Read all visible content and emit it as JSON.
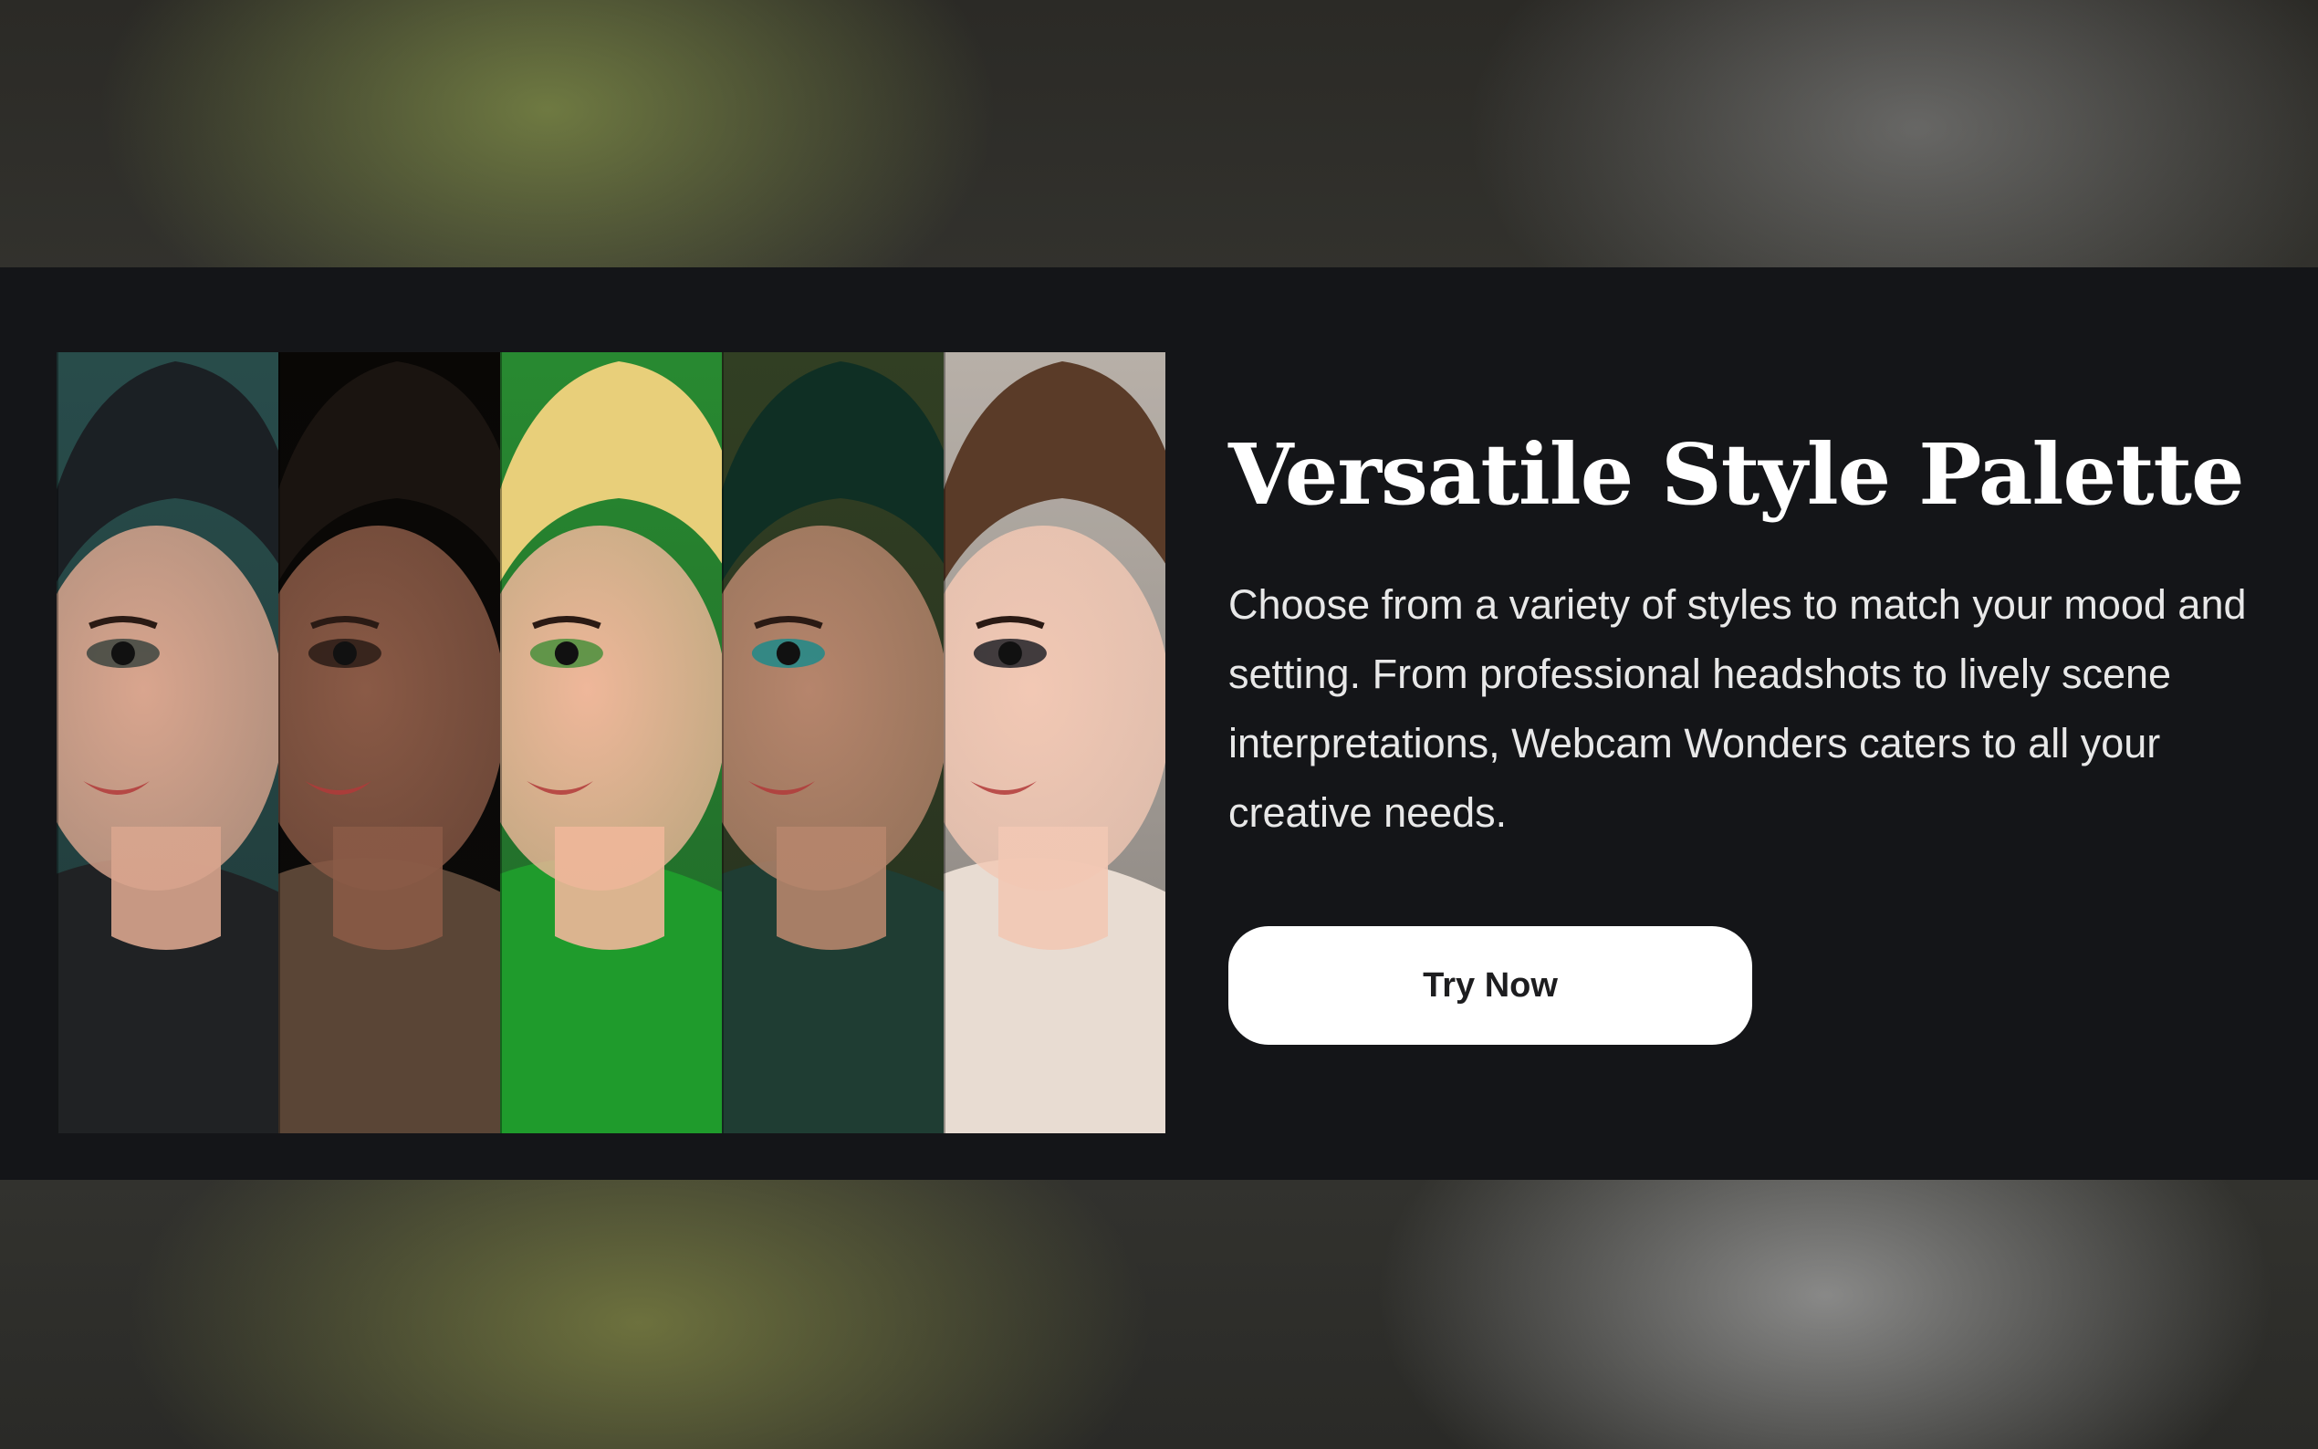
{
  "feature": {
    "title": "Versatile Style Palette",
    "description": "Choose from a variety of styles to match your mood and setting. From professional headshots to lively scene interpretations, Webcam Wonders caters to all your creative needs.",
    "cta_label": "Try Now"
  },
  "gallery": {
    "items": [
      {
        "style": "dark-leather",
        "colors": {
          "hair": "#1b2024",
          "skin": "#d9a58e",
          "outfit": "#202224",
          "bg": "#2f5a58",
          "eye": "#3d4540"
        }
      },
      {
        "style": "noir-trenchcoat",
        "colors": {
          "hair": "#1a1410",
          "skin": "#8a5a46",
          "outfit": "#5a4536",
          "bg": "#0b0907",
          "eye": "#2a1c16"
        }
      },
      {
        "style": "green-fantasy",
        "colors": {
          "hair": "#e8cf7a",
          "skin": "#efb79a",
          "outfit": "#1f9b2c",
          "bg": "#2fa23a",
          "eye": "#4a8f3c"
        }
      },
      {
        "style": "teal-mask",
        "colors": {
          "hair": "#0f2f24",
          "skin": "#b6856c",
          "outfit": "#1f3d33",
          "bg": "#3a4a2a",
          "eye": "#1f8a8a"
        }
      },
      {
        "style": "sunglasses-natural",
        "colors": {
          "hair": "#5a3b28",
          "skin": "#f2c8b4",
          "outfit": "#e8dcd2",
          "bg": "#d8cfc6",
          "eye": "#222228"
        }
      }
    ]
  }
}
